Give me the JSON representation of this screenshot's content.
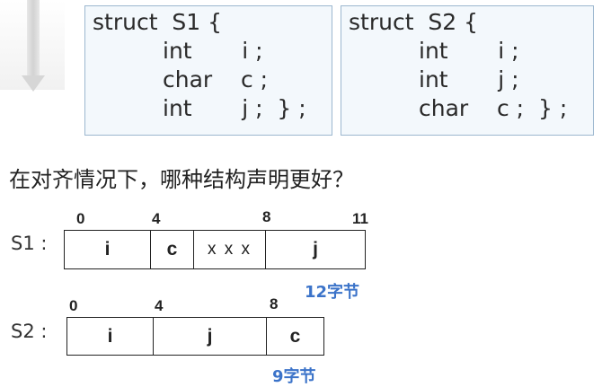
{
  "struct_s1": {
    "lines": [
      "struct  S1 {",
      "int       i ;",
      "char    c ;",
      "int       j ;  } ;"
    ]
  },
  "struct_s2": {
    "lines": [
      "struct  S2 {",
      "int       i ;",
      "int       j ;",
      "char    c ;  } ;"
    ]
  },
  "question": "在对齐情况下，哪种结构声明更好？",
  "s1_layout": {
    "label": "S1 :",
    "offsets": [
      "0",
      "4",
      "8",
      "11"
    ],
    "cells": [
      "i",
      "c",
      "x x x",
      "j"
    ],
    "size_note": "12字节"
  },
  "s2_layout": {
    "label": "S2 :",
    "offsets": [
      "0",
      "4",
      "8"
    ],
    "cells": [
      "i",
      "j",
      "c"
    ],
    "size_note": "9字节"
  }
}
